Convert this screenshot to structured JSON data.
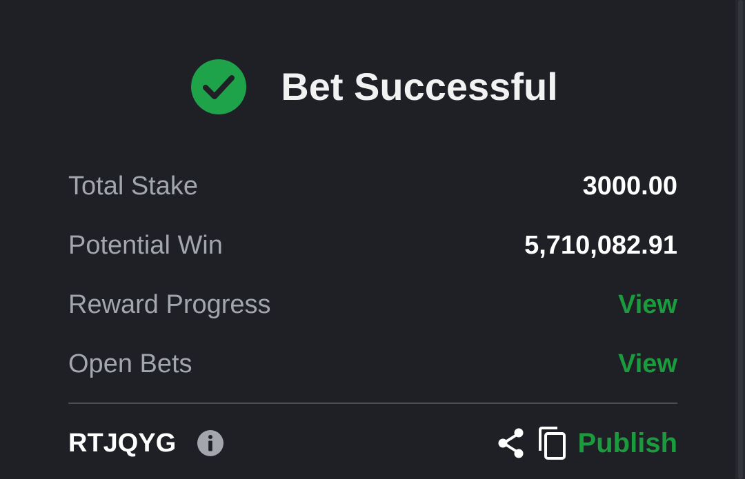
{
  "header": {
    "title": "Bet Successful",
    "icon": "check-circle-icon"
  },
  "summary": {
    "rows": [
      {
        "label": "Total Stake",
        "value": "3000.00"
      },
      {
        "label": "Potential Win",
        "value": "5,710,082.91"
      },
      {
        "label": "Reward Progress",
        "value": "View"
      },
      {
        "label": "Open Bets",
        "value": "View"
      }
    ]
  },
  "footer": {
    "booking_code": "RTJQYG",
    "publish_label": "Publish",
    "icons": [
      "info-icon",
      "share-icon",
      "copy-icon"
    ]
  },
  "colors": {
    "background": "#1e2026",
    "accent_green": "#1c9a3e",
    "success_green": "#1fa34a",
    "label_gray": "#a3a6ad",
    "value_white": "#ffffff"
  }
}
